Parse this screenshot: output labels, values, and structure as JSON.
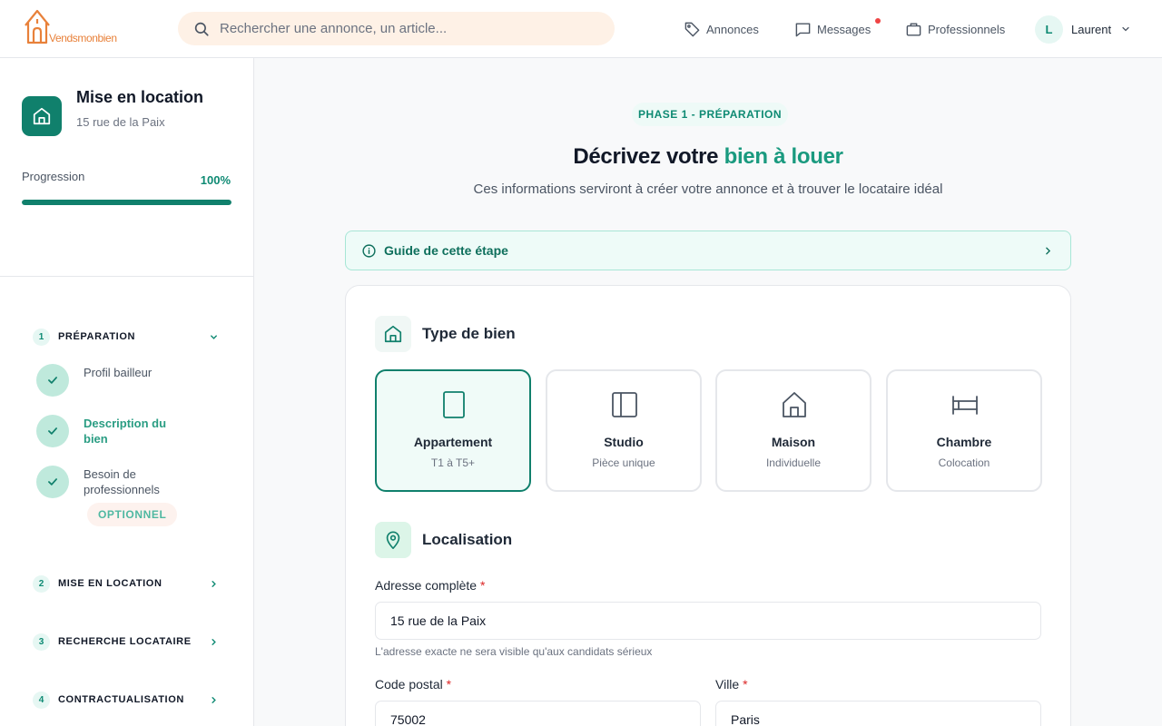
{
  "header": {
    "logo_text": "Vendsmonbien",
    "search_placeholder": "Rechercher une annonce, un article...",
    "nav": {
      "annonces": "Annonces",
      "messages": "Messages",
      "professionnels": "Professionnels"
    },
    "user": {
      "initial": "L",
      "name": "Laurent"
    }
  },
  "sidebar": {
    "project_title": "Mise en location",
    "project_address": "15 rue de la Paix",
    "progress_label": "Progression",
    "progress_value": "100%",
    "progress_fraction": 1.0,
    "phases": [
      {
        "num": "1",
        "label": "PRÉPARATION",
        "expanded": true
      },
      {
        "num": "2",
        "label": "MISE EN LOCATION"
      },
      {
        "num": "3",
        "label": "RECHERCHE LOCATAIRE"
      },
      {
        "num": "4",
        "label": "CONTRACTUALISATION"
      }
    ],
    "steps": [
      {
        "label": "Profil bailleur"
      },
      {
        "label": "Description du bien",
        "active": true
      },
      {
        "label": "Besoin de professionnels",
        "badge": "OPTIONNEL"
      }
    ]
  },
  "main": {
    "phase_tag": "PHASE 1 - PRÉPARATION",
    "heading_prefix": "Décrivez votre ",
    "heading_accent": "bien à louer",
    "subheading": "Ces informations serviront à créer votre annonce et à trouver le locataire idéal",
    "guide_label": "Guide de cette étape",
    "type_section_title": "Type de bien",
    "types": [
      {
        "name": "Appartement",
        "sub": "T1 à T5+",
        "icon": "rectangle-icon",
        "selected": true
      },
      {
        "name": "Studio",
        "sub": "Pièce unique",
        "icon": "panel-icon"
      },
      {
        "name": "Maison",
        "sub": "Individuelle",
        "icon": "house-icon"
      },
      {
        "name": "Chambre",
        "sub": "Colocation",
        "icon": "bed-icon"
      }
    ],
    "location_section_title": "Localisation",
    "address_label": "Adresse complète",
    "address_value": "15 rue de la Paix",
    "address_helper": "L'adresse exacte ne sera visible qu'aux candidats sérieux",
    "postal_label": "Code postal",
    "postal_value": "75002",
    "city_label": "Ville",
    "city_value": "Paris",
    "required_mark": "*"
  },
  "colors": {
    "brand": "#10806c",
    "accent": "#1a9a7f",
    "logo": "#e8813a",
    "search_bg": "#fef1e6",
    "alert": "#ef4444"
  }
}
